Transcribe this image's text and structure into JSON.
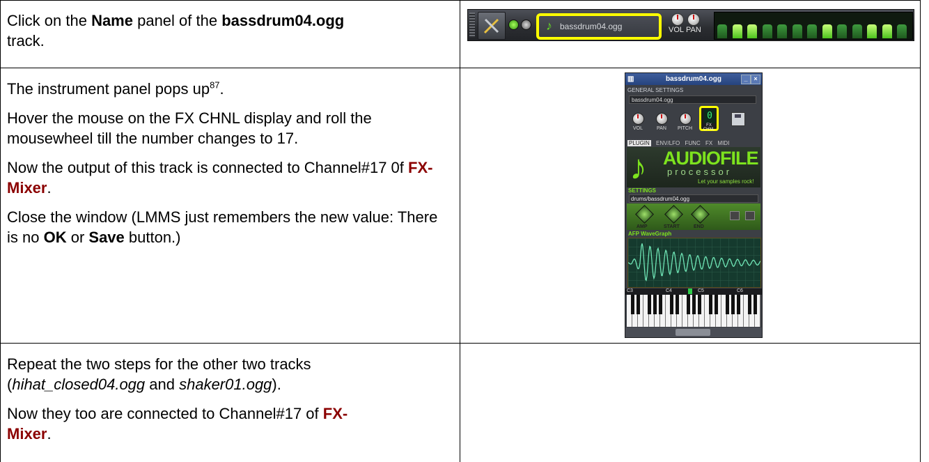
{
  "rows": [
    {
      "lead": "Click on the ",
      "b1": "Name",
      "mid": " panel of the ",
      "b2": "bassdrum04.ogg",
      "tail": " track."
    },
    {
      "p1": "The instrument panel pops up",
      "p1_sup": "87",
      "p1_end": ".",
      "p2": "Hover the mouse on the FX CHNL display and roll the mousewheel till the number changes to 17.",
      "p3_start": "Now the output of this track is connected to Channel#17 0f ",
      "p3_red": "FX-Mixer",
      "p3_end": ".",
      "p4_start": "Close the window (LMMS just remembers the new value: There is no ",
      "p4_b1": "OK",
      "p4_mid": " or ",
      "p4_b2": "Save",
      "p4_end": " button.)"
    },
    {
      "p1_start": "Repeat the two steps for the other two tracks (",
      "p1_i1": "hihat_closed04.ogg",
      "p1_mid": " and ",
      "p1_i2": "shaker01.ogg",
      "p1_end": ").",
      "p2_start": "Now they too are connected to Channel#17 of ",
      "p2_red1": "FX-",
      "p2_red2": "Mixer",
      "p2_end": "."
    }
  ],
  "track_strip": {
    "name": "bassdrum04.ogg",
    "vol_label": "VOL",
    "pan_label": "PAN",
    "highlight_color": "#ffff00",
    "steps_on": [
      false,
      true,
      true,
      false,
      false,
      false,
      false,
      true,
      false,
      false,
      true,
      true,
      false
    ]
  },
  "instrument_window": {
    "title": "bassdrum04.ogg",
    "general_settings": "GENERAL SETTINGS",
    "name": "bassdrum04.ogg",
    "knobs": [
      "VOL",
      "PAN",
      "PITCH"
    ],
    "fx_chnl_value": "0",
    "fx_chnl_label": "FX CHNL",
    "tabs": [
      "PLUGIN",
      "ENV/LFO",
      "FUNC",
      "FX",
      "MIDI"
    ],
    "plugin_title": "AUDIOFILE",
    "plugin_subtitle": "processor",
    "plugin_tagline": "Let your samples rock!",
    "settings_label": "SETTINGS",
    "sample_path": "drums/bassdrum04.ogg",
    "sample_knobs": [
      "AMP",
      "START",
      "END"
    ],
    "wavegraph_label": "AFP WaveGraph",
    "octave_labels": [
      "C3",
      "C4",
      "C5",
      "C6"
    ]
  }
}
